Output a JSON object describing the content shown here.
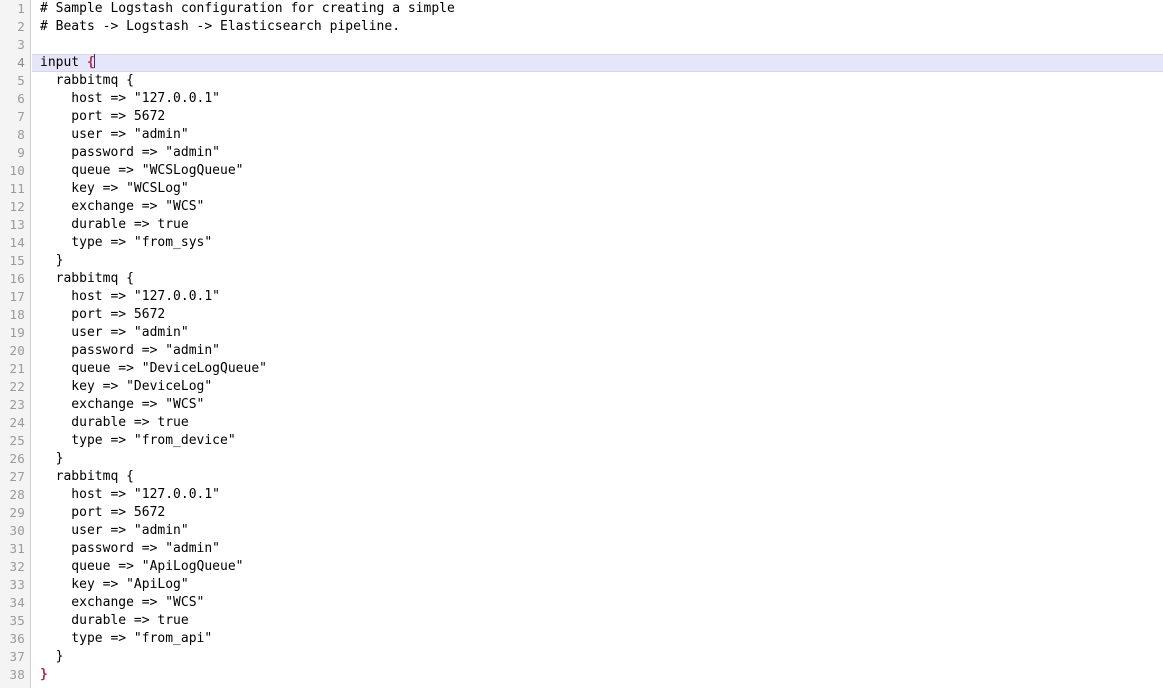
{
  "editor": {
    "name": "logstash-config-editor",
    "language": "logstash-conf",
    "total_lines": 38,
    "current_line": 4,
    "cursor_column": 9,
    "colors": {
      "background": "#ffffff",
      "gutter_background": "#f4f4f4",
      "gutter_border": "#cfcfcf",
      "line_number": "#9a9a9a",
      "text": "#000000",
      "current_line_highlight": "#e6e6fa",
      "matched_brace": "#b02a4a",
      "caret": "#3b2e6e"
    }
  },
  "lines": [
    {
      "n": "1",
      "text": "# Sample Logstash configuration for creating a simple"
    },
    {
      "n": "2",
      "text": "# Beats -> Logstash -> Elasticsearch pipeline."
    },
    {
      "n": "3",
      "text": ""
    },
    {
      "n": "4",
      "text": "input ",
      "brace": "{",
      "current": true,
      "caret": true
    },
    {
      "n": "5",
      "text": "  rabbitmq {"
    },
    {
      "n": "6",
      "text": "    host => \"127.0.0.1\""
    },
    {
      "n": "7",
      "text": "    port => 5672"
    },
    {
      "n": "8",
      "text": "    user => \"admin\""
    },
    {
      "n": "9",
      "text": "    password => \"admin\""
    },
    {
      "n": "10",
      "text": "    queue => \"WCSLogQueue\""
    },
    {
      "n": "11",
      "text": "    key => \"WCSLog\""
    },
    {
      "n": "12",
      "text": "    exchange => \"WCS\""
    },
    {
      "n": "13",
      "text": "    durable => true"
    },
    {
      "n": "14",
      "text": "    type => \"from_sys\""
    },
    {
      "n": "15",
      "text": "  }"
    },
    {
      "n": "16",
      "text": "  rabbitmq {"
    },
    {
      "n": "17",
      "text": "    host => \"127.0.0.1\""
    },
    {
      "n": "18",
      "text": "    port => 5672"
    },
    {
      "n": "19",
      "text": "    user => \"admin\""
    },
    {
      "n": "20",
      "text": "    password => \"admin\""
    },
    {
      "n": "21",
      "text": "    queue => \"DeviceLogQueue\""
    },
    {
      "n": "22",
      "text": "    key => \"DeviceLog\""
    },
    {
      "n": "23",
      "text": "    exchange => \"WCS\""
    },
    {
      "n": "24",
      "text": "    durable => true"
    },
    {
      "n": "25",
      "text": "    type => \"from_device\""
    },
    {
      "n": "26",
      "text": "  }"
    },
    {
      "n": "27",
      "text": "  rabbitmq {"
    },
    {
      "n": "28",
      "text": "    host => \"127.0.0.1\""
    },
    {
      "n": "29",
      "text": "    port => 5672"
    },
    {
      "n": "30",
      "text": "    user => \"admin\""
    },
    {
      "n": "31",
      "text": "    password => \"admin\""
    },
    {
      "n": "32",
      "text": "    queue => \"ApiLogQueue\""
    },
    {
      "n": "33",
      "text": "    key => \"ApiLog\""
    },
    {
      "n": "34",
      "text": "    exchange => \"WCS\""
    },
    {
      "n": "35",
      "text": "    durable => true"
    },
    {
      "n": "36",
      "text": "    type => \"from_api\""
    },
    {
      "n": "37",
      "text": "  }"
    },
    {
      "n": "38",
      "text": "",
      "brace": "}"
    }
  ]
}
